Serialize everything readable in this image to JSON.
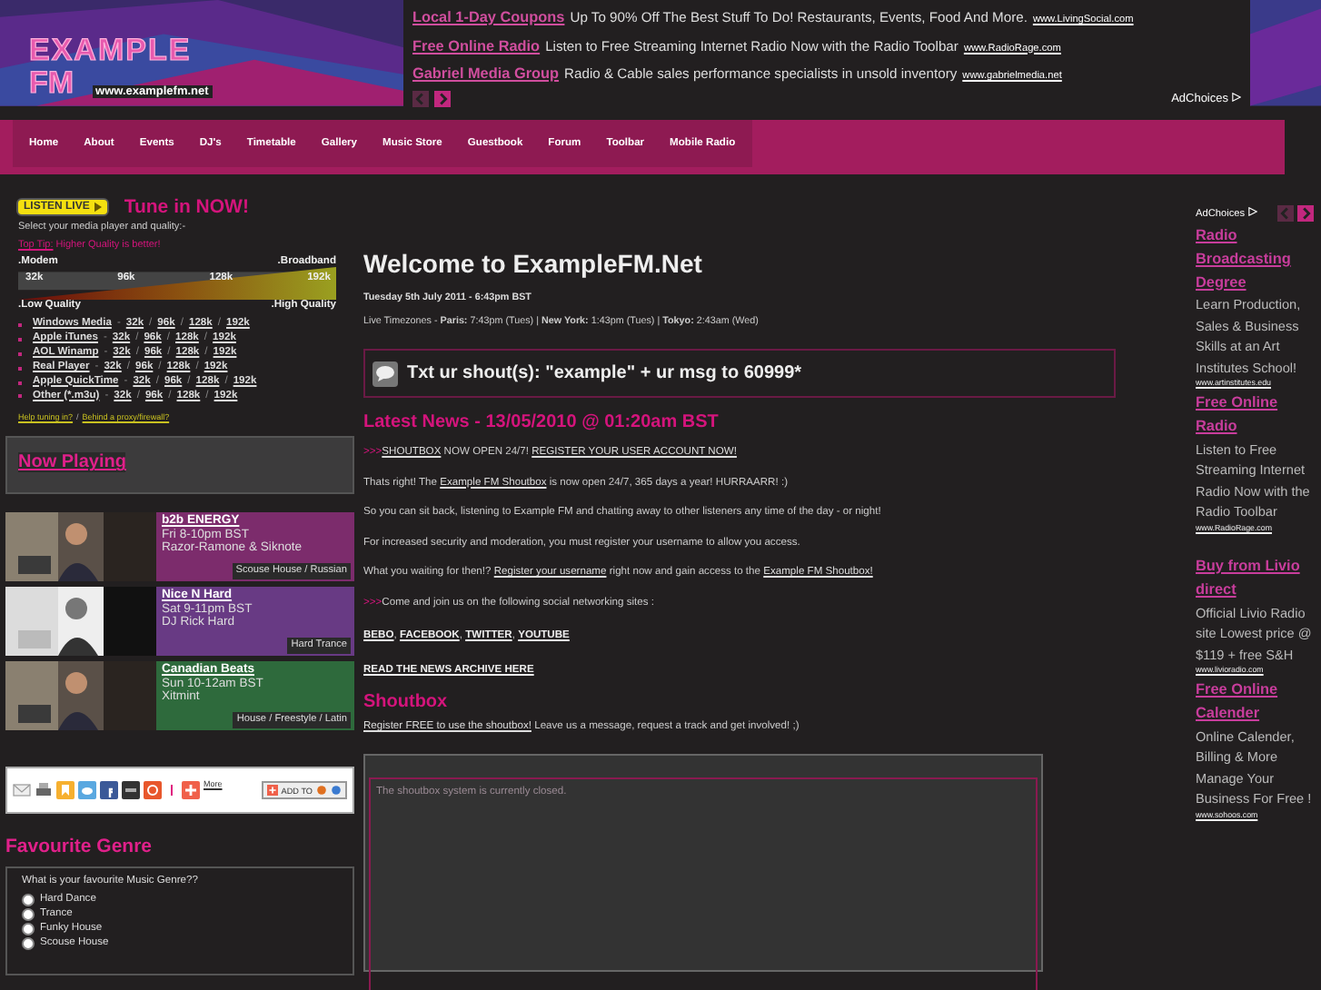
{
  "logo": {
    "name": "EXAMPLE",
    "sub": "FM",
    "url": "www.examplefm.net"
  },
  "header_ads": [
    {
      "title": "Local 1-Day Coupons",
      "text": "Up To 90% Off The Best Stuff To Do! Restaurants, Events, Food And More.",
      "url": "www.LivingSocial.com"
    },
    {
      "title": "Free Online Radio",
      "text": "Listen to Free Streaming Internet Radio Now with the Radio Toolbar",
      "url": "www.RadioRage.com"
    },
    {
      "title": "Gabriel Media Group",
      "text": "Radio & Cable sales performance specialists in unsold inventory",
      "url": "www.gabrielmedia.net"
    }
  ],
  "header_ad_choices": "AdChoices",
  "side_ad_choices": "AdChoices",
  "nav": [
    "Home",
    "About",
    "Events",
    "DJ's",
    "Timetable",
    "Gallery",
    "Music Store",
    "Guestbook",
    "Forum",
    "Toolbar",
    "Mobile Radio"
  ],
  "listen": {
    "badge": "LISTEN LIVE",
    "title": "Tune in NOW!",
    "intro": "Select your media player and quality:-",
    "tip_link": "Top Tip:",
    "tip_text": " Higher Quality is better!",
    "graph": {
      "top_left": ".Modem",
      "top_right": ".Broadband",
      "rates": [
        "32k",
        "96k",
        "128k",
        "192k"
      ],
      "bottom_left": ".Low Quality",
      "bottom_right": ".High Quality"
    },
    "name_separator": "-",
    "rate_separator": "/",
    "players": [
      {
        "name": "Windows Media",
        "rates": [
          "32k",
          "96k",
          "128k",
          "192k"
        ]
      },
      {
        "name": "Apple iTunes",
        "rates": [
          "32k",
          "96k",
          "128k",
          "192k"
        ]
      },
      {
        "name": "AOL Winamp",
        "rates": [
          "32k",
          "96k",
          "128k",
          "192k"
        ]
      },
      {
        "name": "Real Player",
        "rates": [
          "32k",
          "96k",
          "128k",
          "192k"
        ]
      },
      {
        "name": "Apple QuickTime",
        "rates": [
          "32k",
          "96k",
          "128k",
          "192k"
        ]
      },
      {
        "name": "Other (*.m3u)",
        "rates": [
          "32k",
          "96k",
          "128k",
          "192k"
        ]
      }
    ],
    "help_links": [
      "Help tuning in?",
      "Behind a proxy/firewall?"
    ]
  },
  "now_playing": "Now Playing",
  "shows": [
    {
      "title": "b2b ENERGY",
      "time": "Fri 8-10pm BST",
      "dj": "Razor-Ramone & Siknote",
      "genre": "Scouse House / Russian",
      "color": "#7c2c6c"
    },
    {
      "title": "Nice N Hard",
      "time": "Sat 9-11pm BST",
      "dj": "DJ Rick Hard",
      "genre": "Hard Trance",
      "color": "#683a84"
    },
    {
      "title": "Canadian Beats",
      "time": "Sun 10-12am BST",
      "dj": "Xitmint",
      "genre": "House / Freestyle / Latin",
      "color": "#2e6a3c"
    }
  ],
  "share": {
    "more": "More",
    "add_to": "ADD TO"
  },
  "poll": {
    "title": "Favourite Genre",
    "question": "What is your favourite Music Genre??",
    "options": [
      {
        "label": "Hard Dance",
        "selected": false
      },
      {
        "label": "Trance",
        "selected": false
      },
      {
        "label": "Funky House",
        "selected": false
      },
      {
        "label": "Scouse House",
        "selected": false
      }
    ]
  },
  "welcome": {
    "title": "Welcome to ExampleFM.Net",
    "date": "Tuesday 5th July 2011 - 6:43pm BST",
    "timezones": "Live Timezones - **Paris:** 7:43pm (Tues) | **New York:** 1:43pm (Tues) | **Tokyo:** 2:43am (Wed)"
  },
  "shout_sms": "Txt ur shout(s): \"example\" + ur msg to 60999*",
  "news": {
    "title": "Latest News - 13/05/2010 @ 01:20am BST",
    "paragraphs": [
      [
        {
          "kind": "marker",
          "text": ">>>"
        },
        {
          "kind": "link",
          "text": "SHOUTBOX"
        },
        {
          "kind": "text",
          "text": " NOW OPEN 24/7! "
        },
        {
          "kind": "link",
          "text": "REGISTER YOUR USER ACCOUNT NOW!"
        }
      ],
      [
        {
          "kind": "text",
          "text": "Thats right! The "
        },
        {
          "kind": "link",
          "text": "Example FM Shoutbox"
        },
        {
          "kind": "text",
          "text": " is now open 24/7, 365 days a year! HURRAARR! :)"
        }
      ],
      [
        {
          "kind": "text",
          "text": "So you can sit back, listening to Example FM and chatting away to other listeners any time of the day - or night!"
        }
      ],
      [
        {
          "kind": "text",
          "text": "For increased security and moderation, you must register your username to allow you access."
        }
      ],
      [
        {
          "kind": "text",
          "text": "What you waiting for then!? "
        },
        {
          "kind": "link",
          "text": "Register your username"
        },
        {
          "kind": "text",
          "text": " right now and gain access to the "
        },
        {
          "kind": "link",
          "text": "Example FM Shoutbox!"
        }
      ],
      [
        {
          "kind": "marker",
          "text": ">>>"
        },
        {
          "kind": "text",
          "text": "Come and join us on the following social networking sites :"
        }
      ],
      [
        {
          "kind": "bold-link",
          "text": "BEBO"
        },
        {
          "kind": "text",
          "text": ", "
        },
        {
          "kind": "bold-link",
          "text": "FACEBOOK"
        },
        {
          "kind": "text",
          "text": ", "
        },
        {
          "kind": "bold-link",
          "text": "TWITTER"
        },
        {
          "kind": "text",
          "text": ", "
        },
        {
          "kind": "bold-link",
          "text": "YOUTUBE"
        }
      ],
      [
        {
          "kind": "bold-link",
          "text": "READ THE NEWS ARCHIVE HERE"
        }
      ]
    ]
  },
  "shoutbox": {
    "title": "Shoutbox",
    "link": "Register FREE to use the shoutbox!",
    "text": " Leave us a message, request a track and get involved! ;)",
    "status": "The shoutbox system is currently closed."
  },
  "side_ads": [
    {
      "title": "Radio Broadcasting Degree",
      "text": "Learn Production, Sales & Business Skills at an Art Institutes School!",
      "url": "www.artinstitutes.edu"
    },
    {
      "title": "Free Online Radio",
      "text": "Listen to Free Streaming Internet Radio Now with the Radio Toolbar",
      "url": "www.RadioRage.com"
    },
    {
      "title": "Buy from Livio direct",
      "text": "Official Livio Radio site Lowest price @ $119 + free S&H",
      "url": "www.livioradio.com"
    },
    {
      "title": "Free Online Calender",
      "text": "Online Calender, Billing & More Manage Your Business For Free !",
      "url": "www.sohoos.com"
    }
  ]
}
